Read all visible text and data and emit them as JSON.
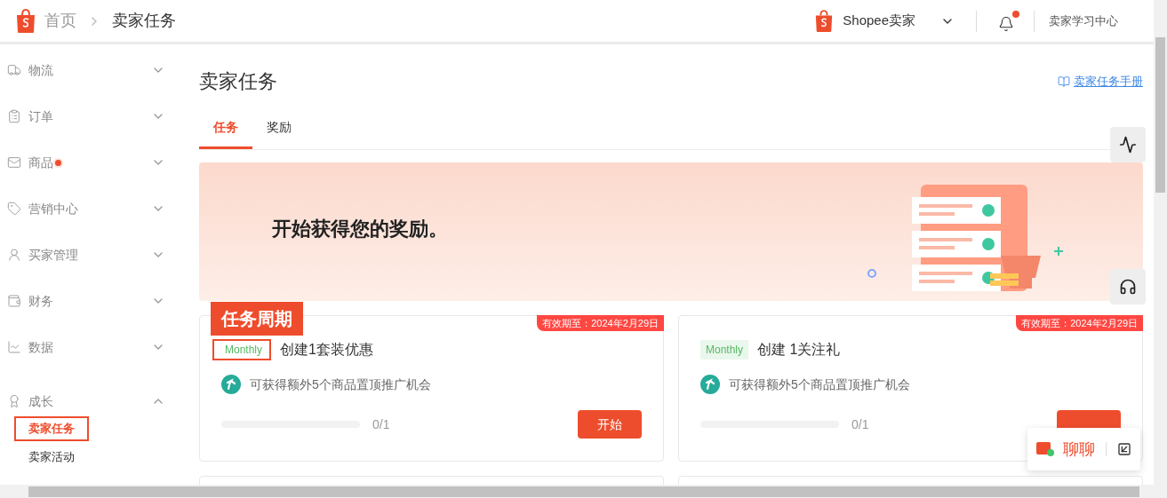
{
  "breadcrumb": {
    "home": "首页",
    "current": "卖家任务"
  },
  "header": {
    "shop_name": "Shopee卖家",
    "notification_dot": true,
    "learning_center": "卖家学习中心"
  },
  "sidebar": {
    "items": [
      {
        "label": "物流",
        "kind": "truck",
        "expanded": false
      },
      {
        "label": "订单",
        "kind": "clipboard",
        "expanded": false
      },
      {
        "label": "商品",
        "kind": "bag",
        "expanded": false,
        "badge_dot": true
      },
      {
        "label": "营销中心",
        "kind": "tag",
        "expanded": false
      },
      {
        "label": "买家管理",
        "kind": "person",
        "expanded": false
      },
      {
        "label": "财务",
        "kind": "wallet",
        "expanded": false
      },
      {
        "label": "数据",
        "kind": "chart",
        "expanded": false
      },
      {
        "label": "成长",
        "kind": "medal",
        "expanded": true,
        "children": [
          {
            "label": "卖家任务",
            "selected": true,
            "highlighted": true
          },
          {
            "label": "卖家活动",
            "selected": false,
            "highlighted": false
          }
        ]
      }
    ]
  },
  "page": {
    "title": "卖家任务",
    "handbook_link": "卖家任务手册",
    "tabs": [
      {
        "label": "任务",
        "selected": true
      },
      {
        "label": "奖励",
        "selected": false
      }
    ],
    "banner": {
      "text": "开始获得您的奖励。"
    },
    "annotation": {
      "label": "任务周期"
    },
    "tasks": [
      {
        "expiry": "有效期至：2024年2月29日",
        "period": "Monthly",
        "period_highlighted": true,
        "title": "创建1套装优惠",
        "reward": "可获得额外5个商品置顶推广机会",
        "progress": {
          "level": 0,
          "text": "0/1"
        },
        "button": "开始"
      },
      {
        "expiry": "有效期至：2024年2月29日",
        "period": "Monthly",
        "period_highlighted": false,
        "title": "创建 1关注礼",
        "reward": "可获得额外5个商品置顶推广机会",
        "progress": {
          "level": 0,
          "text": "0/1"
        }
      }
    ]
  },
  "chat": {
    "label": "聊聊"
  }
}
